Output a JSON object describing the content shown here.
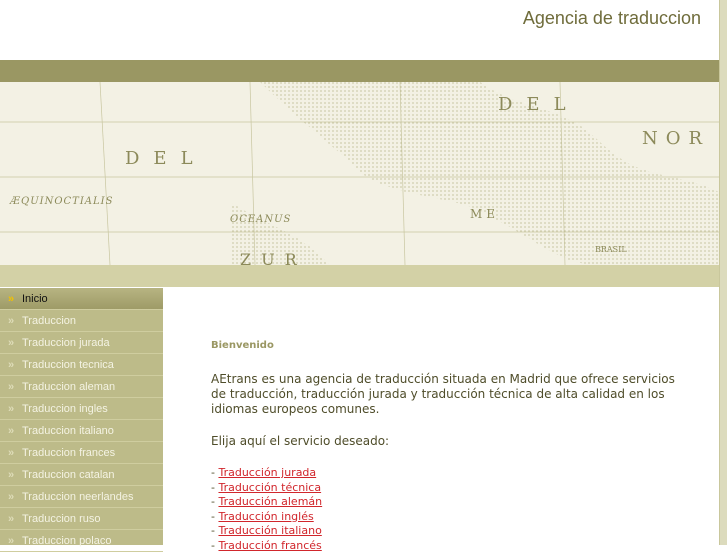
{
  "header": {
    "title": "Agencia de traduccion"
  },
  "banner": {
    "map_labels": [
      "DEL",
      "DEL",
      "NOR",
      "ÆQUINOCTIALIS",
      "OCEANUS",
      "ME",
      "BRASIL",
      "ZUR"
    ]
  },
  "sidebar": {
    "items": [
      {
        "label": "Inicio",
        "active": true
      },
      {
        "label": "Traduccion"
      },
      {
        "label": "Traduccion jurada"
      },
      {
        "label": "Traduccion tecnica"
      },
      {
        "label": "Traduccion aleman"
      },
      {
        "label": "Traduccion ingles"
      },
      {
        "label": "Traduccion italiano"
      },
      {
        "label": "Traduccion frances"
      },
      {
        "label": "Traduccion catalan"
      },
      {
        "label": "Traduccion neerlandes"
      },
      {
        "label": "Traduccion ruso"
      },
      {
        "label": "Traduccion polaco"
      }
    ]
  },
  "content": {
    "heading": "Bienvenido",
    "intro": "AEtrans es una agencia de traducción situada en Madrid que ofrece servicios de traducción, traducción jurada y traducción técnica de alta calidad en los idiomas europeos comunes.",
    "choose": "Elija aquí el servicio deseado:",
    "bullet": "- ",
    "links": [
      "Traducción jurada",
      "Traducción técnica",
      "Traducción alemán",
      "Traducción inglés",
      "Traducción italiano",
      "Traducción francés"
    ]
  }
}
